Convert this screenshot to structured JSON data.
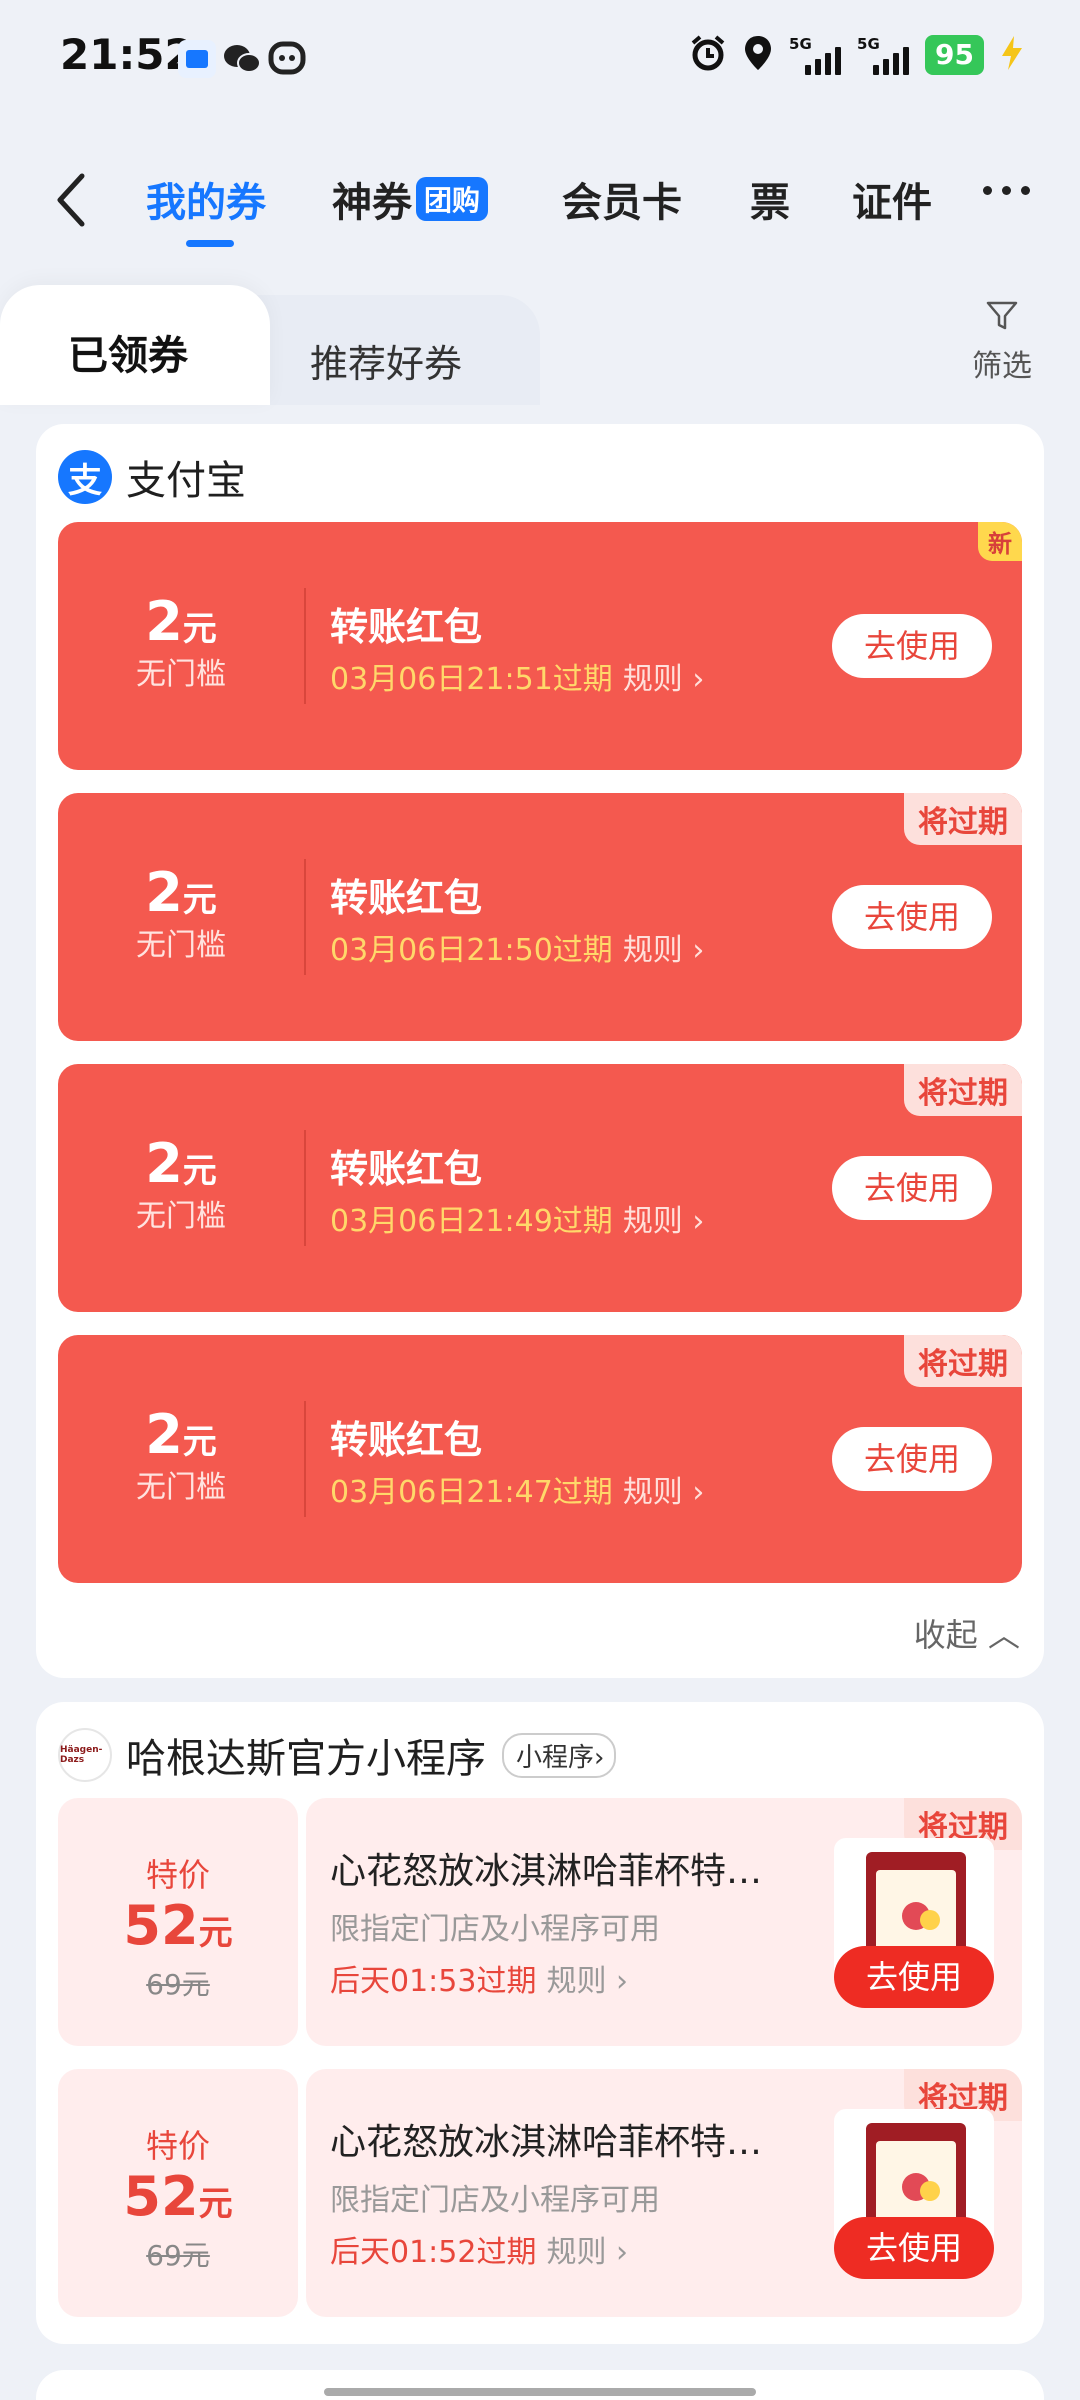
{
  "status_bar": {
    "time": "21:52",
    "battery": "95",
    "net1": "5G",
    "net2": "5G"
  },
  "nav": {
    "tabs": [
      {
        "label": "我的券"
      },
      {
        "label": "神券",
        "badge": "团购"
      },
      {
        "label": "会员卡"
      },
      {
        "label": "票"
      },
      {
        "label": "证件"
      }
    ]
  },
  "sub_tabs": {
    "received": "已领券",
    "recommended": "推荐好券",
    "filter": "筛选"
  },
  "alipay_section": {
    "logo": "支",
    "name": "支付宝",
    "collapse": "收起",
    "coupons": [
      {
        "amount": "2",
        "unit": "元",
        "threshold": "无门槛",
        "title": "转账红包",
        "expiry": "03月06日21:51过期",
        "rule": "规则",
        "action": "去使用",
        "flag": "新"
      },
      {
        "amount": "2",
        "unit": "元",
        "threshold": "无门槛",
        "title": "转账红包",
        "expiry": "03月06日21:50过期",
        "rule": "规则",
        "action": "去使用",
        "flag": "将过期"
      },
      {
        "amount": "2",
        "unit": "元",
        "threshold": "无门槛",
        "title": "转账红包",
        "expiry": "03月06日21:49过期",
        "rule": "规则",
        "action": "去使用",
        "flag": "将过期"
      },
      {
        "amount": "2",
        "unit": "元",
        "threshold": "无门槛",
        "title": "转账红包",
        "expiry": "03月06日21:47过期",
        "rule": "规则",
        "action": "去使用",
        "flag": "将过期"
      }
    ]
  },
  "haagen_section": {
    "name": "哈根达斯官方小程序",
    "tag": "小程序",
    "coupons": [
      {
        "label": "特价",
        "price": "52",
        "unit": "元",
        "orig": "69元",
        "title": "心花怒放冰淇淋哈菲杯特…",
        "desc": "限指定门店及小程序可用",
        "expiry": "后天01:53过期",
        "rule": "规则",
        "action": "去使用",
        "flag": "将过期"
      },
      {
        "label": "特价",
        "price": "52",
        "unit": "元",
        "orig": "69元",
        "title": "心花怒放冰淇淋哈菲杯特…",
        "desc": "限指定门店及小程序可用",
        "expiry": "后天01:52过期",
        "rule": "规则",
        "action": "去使用",
        "flag": "将过期"
      }
    ]
  }
}
